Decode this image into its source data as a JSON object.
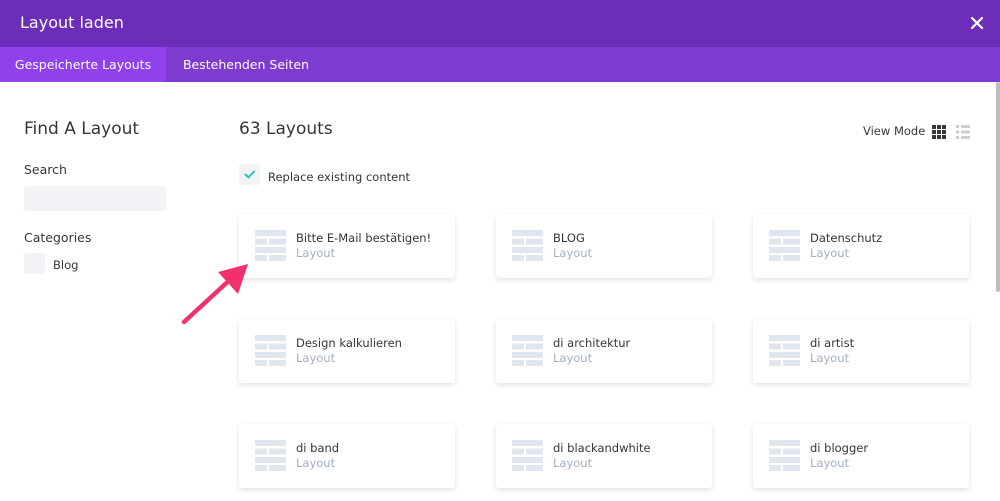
{
  "window": {
    "title": "Layout laden"
  },
  "tabs": [
    {
      "label": "Gespeicherte Layouts"
    },
    {
      "label": "Bestehenden Seiten"
    }
  ],
  "sidebar": {
    "title": "Find A Layout",
    "search_label": "Search",
    "search_value": "",
    "categories_label": "Categories",
    "categories": [
      {
        "label": "Blog"
      }
    ]
  },
  "main": {
    "count_title": "63 Layouts",
    "view_mode_label": "View Mode",
    "replace_label": "Replace existing content",
    "replace_checked": true
  },
  "layouts": [
    {
      "name": "Bitte E-Mail bestätigen!",
      "type": "Layout"
    },
    {
      "name": "BLOG",
      "type": "Layout"
    },
    {
      "name": "Datenschutz",
      "type": "Layout"
    },
    {
      "name": "Design kalkulieren",
      "type": "Layout"
    },
    {
      "name": "di architektur",
      "type": "Layout"
    },
    {
      "name": "di artist",
      "type": "Layout"
    },
    {
      "name": "di band",
      "type": "Layout"
    },
    {
      "name": "di blackandwhite",
      "type": "Layout"
    },
    {
      "name": "di blogger",
      "type": "Layout"
    }
  ],
  "colors": {
    "header": "#6c2eb9",
    "tabbar": "#7e3bd0",
    "tab_active": "#8f42ec",
    "checkmark": "#2cc6b5",
    "annotation_arrow": "#f0316b",
    "muted_text": "#a3b0c2"
  },
  "icons": {
    "close": "close-icon",
    "view_grid": "grid-view-icon",
    "view_list": "list-view-icon",
    "layout_thumb": "layout-thumbnail-icon",
    "annotation": "arrow-annotation"
  }
}
